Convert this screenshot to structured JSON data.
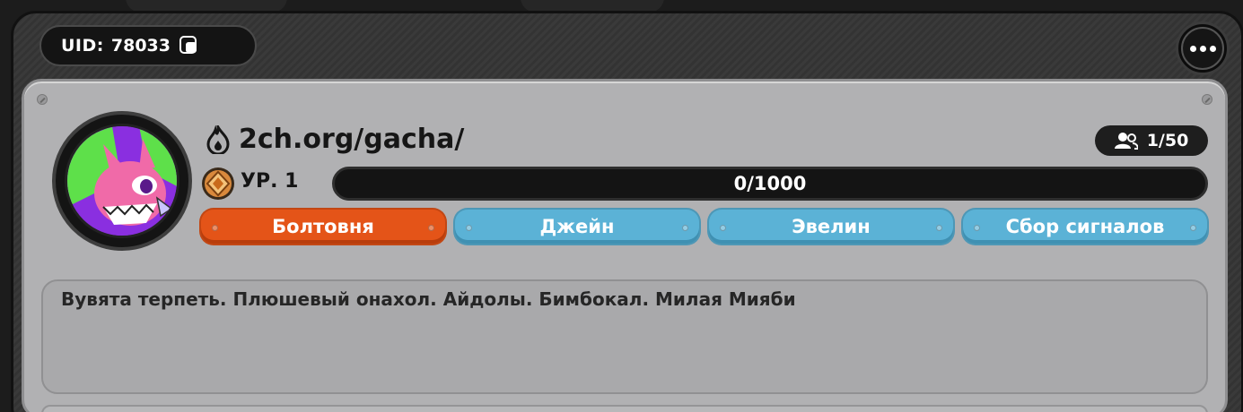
{
  "header": {
    "uid_label": "UID:",
    "uid_value": "78033"
  },
  "club": {
    "name": "2ch.org/gacha/",
    "members": "1/50",
    "level_label": "УР. 1",
    "xp_text": "0/1000",
    "xp_progress": 0
  },
  "tags": [
    {
      "label": "Болтовня",
      "active": true
    },
    {
      "label": "Джейн",
      "active": false
    },
    {
      "label": "Эвелин",
      "active": false
    },
    {
      "label": "Сбор сигналов",
      "active": false
    }
  ],
  "description": "Вувята терпеть. Плюшевый онахол. Айдолы. Бимбокал. Милая Мияби",
  "colors": {
    "active_tag": "#e45418",
    "inactive_tag": "#5bb2d6",
    "panel": "#b1b1b3"
  }
}
